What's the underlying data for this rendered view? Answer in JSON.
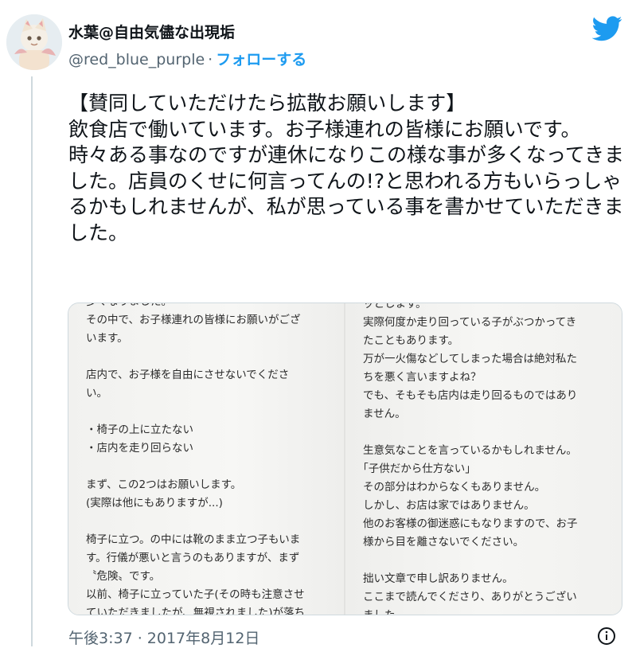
{
  "author": {
    "name": "水葉@自由気儘な出現垢",
    "handle": "@red_blue_purple",
    "separator": "·",
    "follow_label": "フォローする"
  },
  "tweet": {
    "lines": [
      "【賛同していただけたら拡散お願いします】",
      "飲食店で働いています。お子様連れの皆様にお願いです。",
      "時々ある事なのですが連休になりこの様な事が多くなってきました。店員のくせに何言ってんの!?と思われる方もいらっしゃるかもしれませんが、私が思っている事を書かせていただきました。"
    ]
  },
  "media": {
    "left_text": "多くなりました。\nその中で、お子様連れの皆様にお願いがござ\nいます。\n\n店内で、お子様を自由にさせないでくださ\nい。\n\n・椅子の上に立たない\n・店内を走り回らない\n\nまず、この2つはお願いします。\n(実際は他にもありますが...)\n\n椅子に立つ。の中には靴のまま立つ子もいま\nす。行儀が悪いと言うのもありますが、まず\n〝危険〟です。\n以前、椅子に立っていた子(その時も注意させ\nていただきましたが、無視されました)が落ち",
    "right_text": "ッとします。\n実際何度か走り回っている子がぶつかってき\nたこともあります。\n万が一火傷などしてしまった場合は絶対私た\nちを悪く言いますよね？\nでも、そもそも店内は走り回るものではあり\nません。\n\n生意気なことを言っているかもしれません。\n｢子供だから仕方ない｣\nその部分はわからなくもありません。\nしかし、お店は家ではありません。\n他のお客様の御迷惑にもなりますので、お子\n様から目を離さないでください。\n\n拙い文章で申し訳ありません。\nここまで読んでくださり、ありがとうござい\nました。"
  },
  "timestamp": "午後3:37 · 2017年8月12日",
  "colors": {
    "accent": "#1d9bf0",
    "secondary_text": "#536471",
    "primary_text": "#0f1419"
  },
  "icons": {
    "logo": "twitter-bird-icon",
    "info": "info-icon"
  }
}
